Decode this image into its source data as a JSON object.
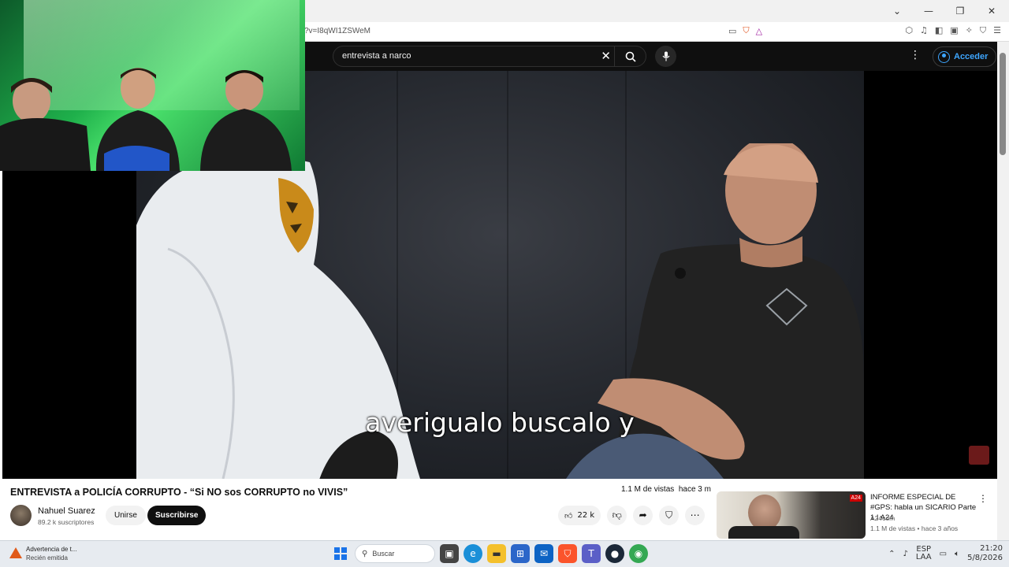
{
  "browser": {
    "url_fragment": "?v=I8qWI1ZSWeM",
    "window_controls": [
      "⌄",
      "—",
      "❐",
      "✕"
    ]
  },
  "youtube": {
    "search": {
      "query": "entrevista a narco"
    },
    "signin_label": "Acceder"
  },
  "video": {
    "subtitle": "averigualo buscalo y",
    "title": "ENTREVISTA a POLICÍA CORRUPTO - “Si NO sos CORRUPTO no VIVIS”",
    "views": "1.1 M de vistas",
    "age": "hace 3 m",
    "likes": "22 k"
  },
  "channel": {
    "name": "Nahuel Suarez",
    "subscribers": "89.2 k suscriptores",
    "join_label": "Unirse",
    "subscribe_label": "Suscribirse"
  },
  "recommendation": {
    "title": "INFORME ESPECIAL DE #GPS: habla un SICARIO Parte 1 I A24",
    "channel": "A24com",
    "meta": "1.1 M de vistas • hace 3 años",
    "thumb_logo": "A24"
  },
  "taskbar": {
    "notification_title": "Advertencia de t...",
    "notification_sub": "Recién emitida",
    "search_placeholder": "Buscar",
    "lang_line1": "ESP",
    "lang_line2": "LAA",
    "time": "21:20",
    "date": "5/8/2026"
  },
  "colors": {
    "yt_dark": "#0f0f0f",
    "signin_blue": "#3ea6ff",
    "webcam_green": "#1fb04b"
  }
}
